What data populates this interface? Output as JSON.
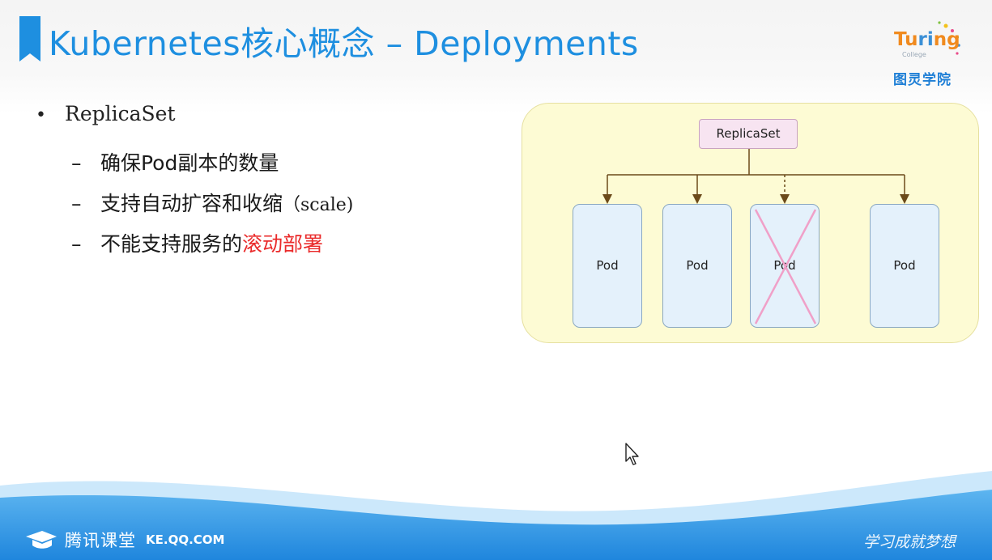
{
  "header": {
    "title": "Kubernetes核心概念 – Deployments",
    "logo": {
      "word_part1": "Tu",
      "word_part2": "ri",
      "word_part3": "ng",
      "subtext": "College",
      "cn_name": "图灵学院"
    }
  },
  "content": {
    "bullet": "ReplicaSet",
    "sub_items": [
      {
        "text": "确保Pod副本的数量"
      },
      {
        "text": "支持自动扩容和收缩",
        "paren": "（scale)"
      },
      {
        "text": "不能支持服务的",
        "highlight": "滚动部署"
      }
    ]
  },
  "diagram": {
    "replicaset_label": "ReplicaSet",
    "pods": [
      {
        "label": "Pod",
        "removed": false
      },
      {
        "label": "Pod",
        "removed": false
      },
      {
        "label": "Pod",
        "removed": true
      },
      {
        "label": "Pod",
        "removed": false
      }
    ]
  },
  "footer": {
    "brand_name": "腾讯课堂",
    "brand_url": "KE.QQ.COM",
    "slogan": "学习成就梦想"
  },
  "colors": {
    "title": "#1e8fe0",
    "highlight": "#ea2b2b",
    "diagram_bg": "#fdfbd4",
    "pod_fill": "#e4f1fb",
    "replicaset_fill": "#f7e4f1",
    "arrow": "#6b4a1a",
    "cross": "#f0a0c8",
    "footer_wave": "#2d8fe0"
  }
}
